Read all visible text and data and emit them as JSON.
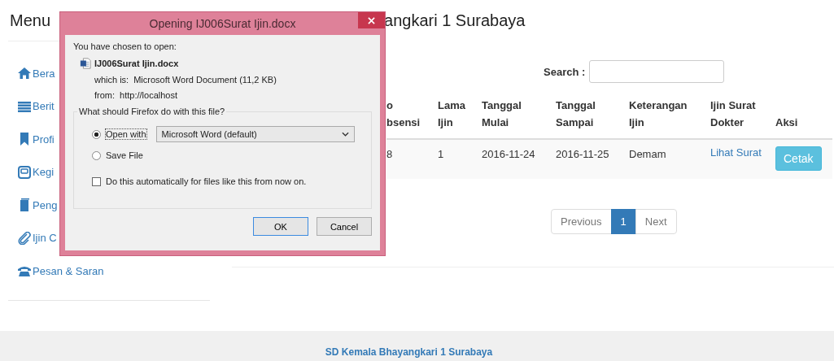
{
  "header": {
    "menu_title": "Menu",
    "page_title": "angkari 1 Surabaya"
  },
  "sidebar": {
    "items": [
      {
        "label": "Bera"
      },
      {
        "label": "Berit"
      },
      {
        "label": "Profi"
      },
      {
        "label": "Kegi"
      },
      {
        "label": "Peng"
      },
      {
        "label": "Ijin C"
      },
      {
        "label": "Pesan & Saran"
      }
    ]
  },
  "search": {
    "label": "Search :"
  },
  "table": {
    "columns": [
      "o\nbsensi",
      "Lama\nIjin",
      "Tanggal\nMulai",
      "Tanggal\nSampai",
      "Keterangan\nIjin",
      "Ijin Surat\nDokter",
      "Aksi"
    ],
    "rows": [
      {
        "cells": [
          {
            "kind": "text",
            "text": "8"
          },
          {
            "kind": "text",
            "text": "1"
          },
          {
            "kind": "text",
            "text": "2016-11-24"
          },
          {
            "kind": "text",
            "text": "2016-11-25"
          },
          {
            "kind": "text",
            "text": "Demam"
          },
          {
            "kind": "link",
            "text": "Lihat Surat"
          },
          {
            "kind": "button",
            "text": "Cetak"
          }
        ]
      }
    ]
  },
  "pagination": [
    {
      "label": "Previous",
      "selected": false
    },
    {
      "label": "1",
      "selected": true
    },
    {
      "label": "Next",
      "selected": false
    }
  ],
  "footer": "SD Kemala Bhayangkari 1 Surabaya",
  "dialog": {
    "title": "Opening IJ006Surat Ijin.docx",
    "intro": "You have chosen to open:",
    "file_name": "IJ006Surat Ijin.docx",
    "which_is_label": "which is:",
    "which_is": "Microsoft Word Document (11,2 KB)",
    "from_label": "from:",
    "from": "http://localhost",
    "group_title": "What should Firefox do with this file?",
    "options": [
      {
        "label": "Open with",
        "selected": true
      },
      {
        "label": "Save File",
        "selected": false
      }
    ],
    "app_select": "Microsoft Word (default)",
    "auto_checkbox": {
      "label": "Do this automatically for files like this from now on.",
      "checked": false
    },
    "buttons": [
      {
        "label": "OK",
        "default": true
      },
      {
        "label": "Cancel",
        "default": false
      }
    ]
  }
}
